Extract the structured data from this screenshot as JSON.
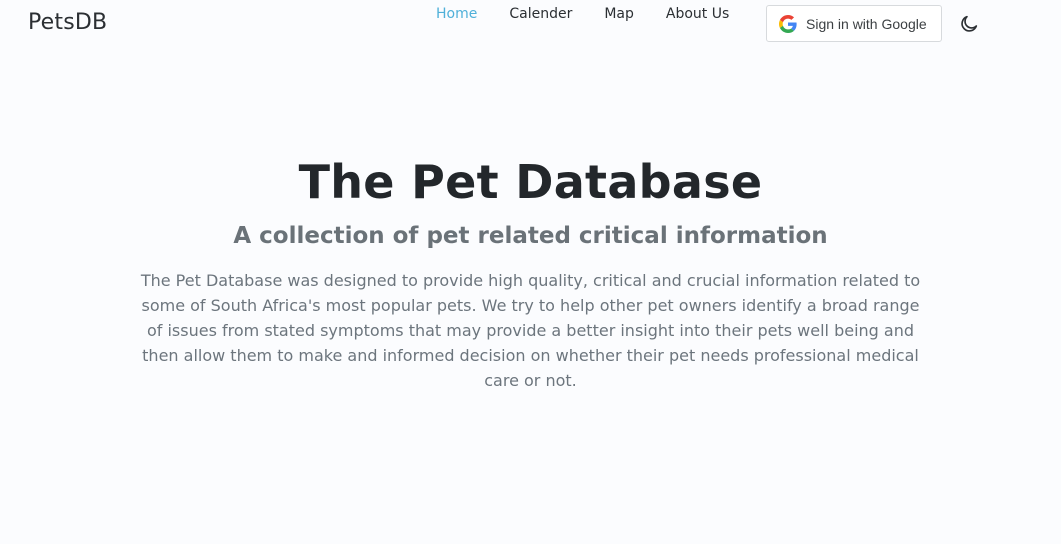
{
  "nav": {
    "brand": "PetsDB",
    "links": [
      {
        "label": "Home",
        "active": true
      },
      {
        "label": "Calender",
        "active": false
      },
      {
        "label": "Map",
        "active": false
      },
      {
        "label": "About Us",
        "active": false
      }
    ],
    "signin_label": "Sign in with Google",
    "signin_icon": "google-icon",
    "theme_icon": "moon-icon"
  },
  "hero": {
    "title": "The Pet Database",
    "subtitle": "A collection of pet related critical information",
    "description": "The Pet Database was designed to provide high quality, critical and crucial information related to some of South Africa's most popular pets. We try to help other pet owners identify a broad range of issues from stated symptoms that may provide a better insight into their pets well being and then allow them to make and informed decision on whether their pet needs professional medical care or not."
  },
  "colors": {
    "accent": "#4fb0d9",
    "background": "#fbfcfe",
    "text": "#2b2f33",
    "muted": "#6c757d"
  }
}
